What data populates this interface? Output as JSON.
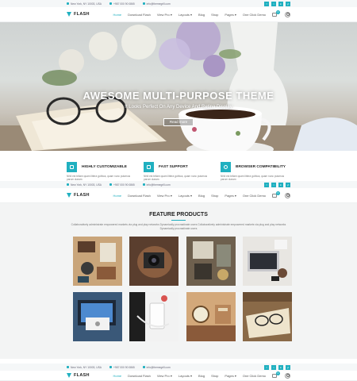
{
  "topbar": {
    "address": "New York, NY 10003, USA",
    "phone": "+987 000 90 0865",
    "email": "info@themegrill.com",
    "social": [
      "f",
      "t",
      "in",
      "yt"
    ]
  },
  "nav": {
    "brand": "FLASH",
    "items": [
      "Home",
      "Download Flash",
      "View Pro ▾",
      "Layouts ▾",
      "Blog",
      "Shop",
      "Pages ▾",
      "One Click Demo"
    ],
    "cart_count": "0"
  },
  "hero": {
    "title": "AWESOME MULTI-PURPOSE THEME",
    "subtitle": "It Looks Perfect On Any Device And Retina Display",
    "button": "Read more"
  },
  "features": [
    {
      "title": "HIGHLY CUSTOMIZABLE",
      "desc": "Nihil est tellam quam littera gothica, quam nunc putamus parum claram"
    },
    {
      "title": "FAST SUPPORT",
      "desc": "Nihil est tellam quam littera gothica, quam nunc putamus parum claram"
    },
    {
      "title": "BROWSER COMPATIBILITY",
      "desc": "Nihil est tellam quam littera gothica, quam nunc putamus parum claram"
    }
  ],
  "products": {
    "title": "FEATURE PRODUCTS",
    "description": "Collaboratively administrate empowered markets via plug and play networks Dynamically procrastinate users Collaboratively administrate empowered markets via plug and play networks Dynamically procrastinate users",
    "tiles": [
      "travel-flatlay",
      "camera-bag",
      "vintage-desk",
      "laptop-workspace",
      "tablet-laptop",
      "phone-earphones",
      "vintage-clock",
      "book-glasses"
    ]
  },
  "colors": {
    "accent": "#20b0c0",
    "bg_section": "#f3f4f4"
  }
}
